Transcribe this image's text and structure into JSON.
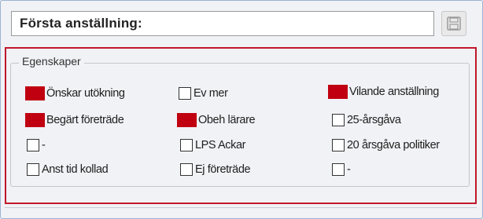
{
  "header": {
    "label": "Första anställning:"
  },
  "toolbar": {
    "save_icon": "save-icon"
  },
  "properties": {
    "title": "Egenskaper",
    "checkboxes": [
      {
        "label": "Önskar utökning",
        "highlighted": true
      },
      {
        "label": "Ev mer",
        "highlighted": false
      },
      {
        "label": "Vilande anställning",
        "highlighted": true
      },
      {
        "label": "Begärt företräde",
        "highlighted": true
      },
      {
        "label": "Obeh lärare",
        "highlighted": true
      },
      {
        "label": "25-årsgåva",
        "highlighted": false
      },
      {
        "label": "-",
        "highlighted": false
      },
      {
        "label": "LPS Ackar",
        "highlighted": false
      },
      {
        "label": "20 årsgåva politiker",
        "highlighted": false
      },
      {
        "label": "Anst tid kollad",
        "highlighted": false
      },
      {
        "label": "Ej företräde",
        "highlighted": false
      },
      {
        "label": "-",
        "highlighted": false
      }
    ]
  },
  "colors": {
    "highlight": "#c00010",
    "annotation_outline": "#c0172a"
  }
}
